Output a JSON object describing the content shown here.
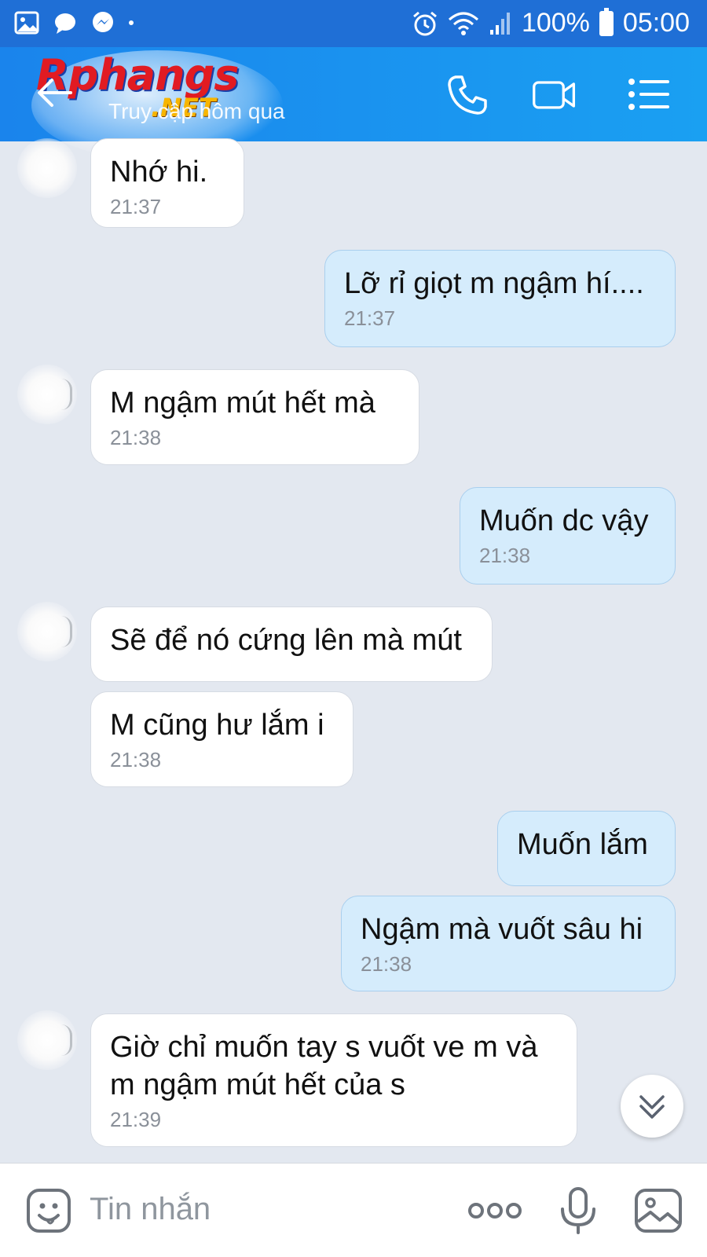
{
  "status_bar": {
    "battery": "100%",
    "time": "05:00",
    "icons": [
      "gallery-icon",
      "chat-bubble-icon",
      "messenger-icon",
      "dot-icon",
      "alarm-icon",
      "wifi-icon",
      "signal-icon",
      "battery-icon"
    ]
  },
  "header": {
    "logo_text": "Rphangs",
    "logo_suffix": ".NET",
    "last_seen": "Truy cập hôm qua",
    "buttons": [
      "back-arrow-icon",
      "phone-icon",
      "video-icon",
      "menu-icon"
    ]
  },
  "messages": [
    {
      "dir": "in",
      "text": "Nhớ hi.",
      "time": "21:37"
    },
    {
      "dir": "out",
      "text": "Lỡ rỉ giọt m ngậm hí....",
      "time": "21:37"
    },
    {
      "dir": "in",
      "text": "M ngậm mút hết mà",
      "time": "21:38"
    },
    {
      "dir": "out",
      "text": "Muốn dc vậy",
      "time": "21:38"
    },
    {
      "dir": "in",
      "text": "Sẽ để nó cứng lên mà mút",
      "time": ""
    },
    {
      "dir": "in",
      "text": "M cũng hư lắm i",
      "time": "21:38"
    },
    {
      "dir": "out",
      "text": "Muốn lắm",
      "time": ""
    },
    {
      "dir": "out",
      "text": "Ngậm mà vuốt sâu hi",
      "time": "21:38"
    },
    {
      "dir": "in",
      "text": "Giờ chỉ muốn tay s vuốt ve m và",
      "text2": "m ngậm mút hết của s",
      "time": "21:39"
    }
  ],
  "input_bar": {
    "placeholder": "Tin nhắn",
    "icons": [
      "sticker-icon",
      "more-icon",
      "microphone-icon",
      "image-icon"
    ]
  },
  "colors": {
    "header_start": "#1a84ec",
    "header_end": "#1aa0f2",
    "status_bar": "#1f6fd6",
    "chat_bg": "#e3e8f0",
    "bubble_in": "#ffffff",
    "bubble_out": "#d5ecfc"
  }
}
